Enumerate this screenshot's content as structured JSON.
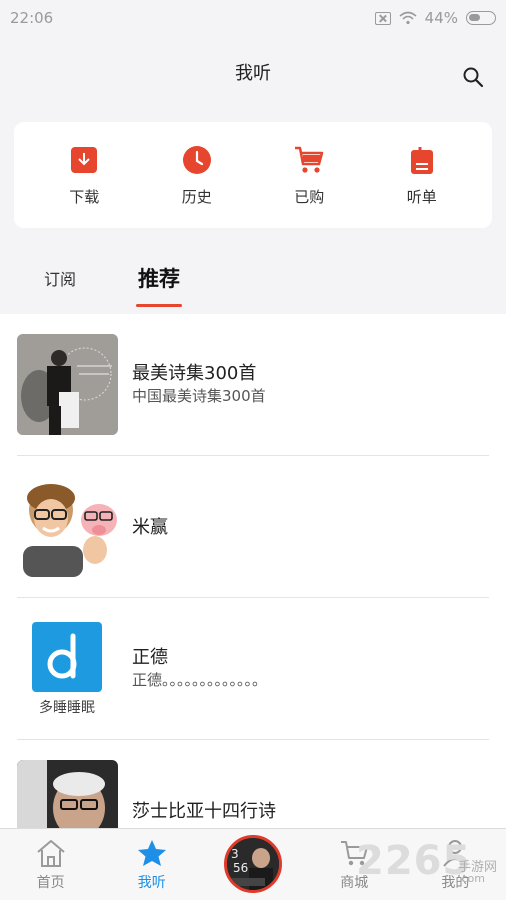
{
  "status_bar": {
    "time": "22:06",
    "battery": "44%"
  },
  "header": {
    "title": "我听"
  },
  "quick_actions": [
    {
      "label": "下载",
      "icon": "download-icon"
    },
    {
      "label": "历史",
      "icon": "clock-icon"
    },
    {
      "label": "已购",
      "icon": "cart-icon"
    },
    {
      "label": "听单",
      "icon": "playlist-icon"
    }
  ],
  "tabs": [
    {
      "label": "订阅",
      "active": false
    },
    {
      "label": "推荐",
      "active": true
    }
  ],
  "recommendations": [
    {
      "title": "最美诗集300首",
      "subtitle": "中国最美诗集300首"
    },
    {
      "title": "米赢",
      "subtitle": ""
    },
    {
      "title": "正德",
      "subtitle": "正德。。。。。。。。。。。。。"
    },
    {
      "title": "莎士比亚十四行诗",
      "subtitle": ""
    }
  ],
  "bottom_nav": {
    "home": "首页",
    "listen": "我听",
    "mall": "商城",
    "mine": "我的"
  },
  "watermark": {
    "brand": "2265",
    "cn": "手游网",
    "url": ".com"
  },
  "colors": {
    "accent": "#e6452e",
    "nav_active": "#1d8fe6"
  }
}
